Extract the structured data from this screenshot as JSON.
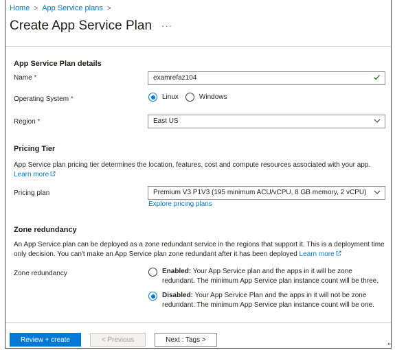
{
  "breadcrumb": {
    "items": [
      "Home",
      "App Service plans"
    ],
    "separator": ">"
  },
  "header": {
    "title": "Create App Service Plan",
    "more": "···"
  },
  "details": {
    "heading": "App Service Plan details",
    "name_label": "Name",
    "name_value": "examrefaz104",
    "os_label": "Operating System",
    "os_options": [
      {
        "label": "Linux",
        "selected": true
      },
      {
        "label": "Windows",
        "selected": false
      }
    ],
    "region_label": "Region",
    "region_value": "East US",
    "required_mark": "*"
  },
  "pricing": {
    "heading": "Pricing Tier",
    "description": "App Service plan pricing tier determines the location, features, cost and compute resources associated with your app.",
    "learn_more": "Learn more",
    "plan_label": "Pricing plan",
    "plan_value": "Premium V3 P1V3 (195 minimum ACU/vCPU, 8 GB memory, 2 vCPU)",
    "explore_link": "Explore pricing plans"
  },
  "zone": {
    "heading": "Zone redundancy",
    "description": "An App Service plan can be deployed as a zone redundant service in the regions that support it. This is a deployment time only decision. You can't make an App Service plan zone redundant after it has been deployed",
    "learn_more": "Learn more",
    "label": "Zone redundancy",
    "options": [
      {
        "title": "Enabled:",
        "text": "Your App Service plan and the apps in it will be zone redundant. The minimum App Service plan instance count will be three.",
        "selected": false
      },
      {
        "title": "Disabled:",
        "text": "Your App Service Plan and the apps in it will not be zone redundant. The minimum App Service plan instance count will be one.",
        "selected": true
      }
    ]
  },
  "footer": {
    "review_create": "Review + create",
    "previous": "< Previous",
    "next": "Next : Tags >"
  },
  "colors": {
    "accent": "#0078d4",
    "required": "#a4262c",
    "valid": "#107c10"
  },
  "icons": {
    "valid": "checkmark-icon",
    "dropdown": "chevron-down-icon",
    "external": "external-link-icon"
  },
  "corner_mark": "↵"
}
